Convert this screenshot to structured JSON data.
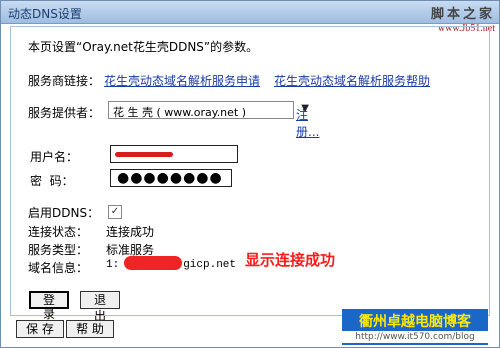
{
  "window": {
    "title": "动态DNS设置"
  },
  "watermark": {
    "title": "脚本之家",
    "url": "www.Jb51.net"
  },
  "intro_text": "本页设置“Oray.net花生壳DDNS”的参数。",
  "service_links": {
    "label": "服务商链接：",
    "link1": "花生壳动态域名解析服务申请",
    "link2": "花生壳动态域名解析服务帮助"
  },
  "provider": {
    "label": "服务提供者：",
    "selected": "花 生 壳 ( www.oray.net )",
    "register": "注册..."
  },
  "username": {
    "label": "用户名：",
    "value": ""
  },
  "password": {
    "label": "密  码：",
    "value": "●●●●●●●●"
  },
  "status": {
    "enable_label": "启用DDNS：",
    "enabled_mark": "✓",
    "conn_label": "连接状态：",
    "conn_value": "连接成功",
    "service_label": "服务类型：",
    "service_value": "标准服务",
    "domain_label": "域名信息：",
    "domain_prefix": "1:",
    "domain_suffix": "gicp.net"
  },
  "annotation": "显示连接成功",
  "buttons": {
    "login": "登 录",
    "exit": "退 出",
    "save": "保 存",
    "help": "帮 助"
  },
  "brand": {
    "name": "衢州卓越电脑博客",
    "url": "http://www.it570.com/blog"
  },
  "colors": {
    "link": "#1a3da5",
    "highlight": "#ff1a1a",
    "brand_bg": "#1b67c8",
    "brand_text": "#ffe800"
  }
}
